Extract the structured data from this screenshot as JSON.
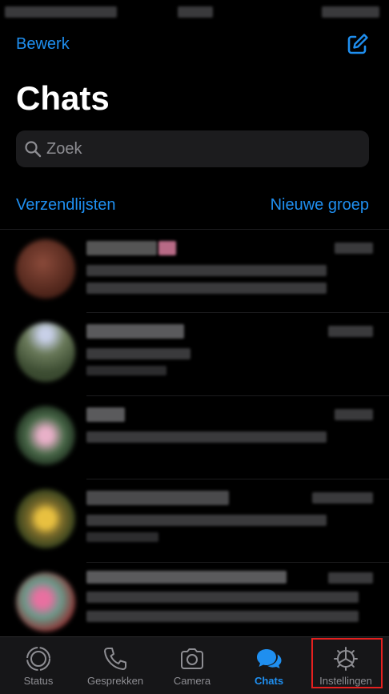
{
  "header": {
    "edit_label": "Bewerk",
    "compose_icon": "compose-icon",
    "title": "Chats"
  },
  "search": {
    "placeholder": "Zoek",
    "icon": "search-icon"
  },
  "links": {
    "broadcast_lists": "Verzendlijsten",
    "new_group": "Nieuwe groep"
  },
  "tabs": [
    {
      "label": "Status",
      "icon": "status-icon"
    },
    {
      "label": "Gesprekken",
      "icon": "phone-icon"
    },
    {
      "label": "Camera",
      "icon": "camera-icon"
    },
    {
      "label": "Chats",
      "icon": "chats-icon",
      "active": true
    },
    {
      "label": "Instellingen",
      "icon": "gear-icon",
      "highlighted": true
    }
  ],
  "colors": {
    "accent": "#1f8ff0",
    "background": "#000000",
    "search_bg": "#1c1c1e",
    "tab_bar_bg": "#161618",
    "inactive": "#8e8e93",
    "highlight": "#e5201f"
  }
}
